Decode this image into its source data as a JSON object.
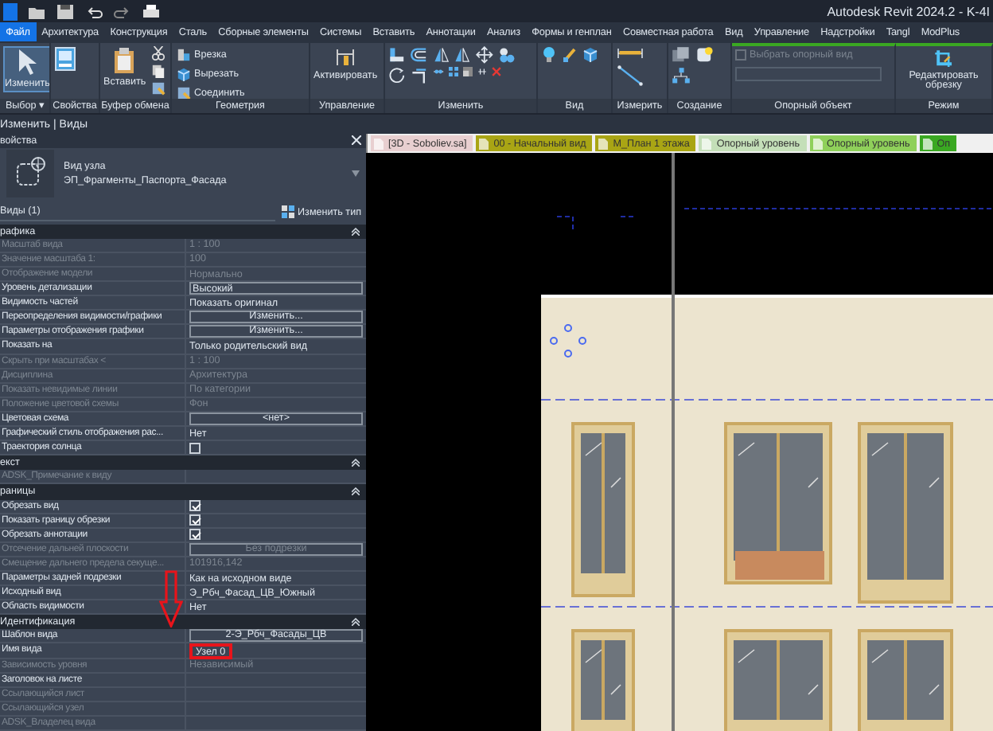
{
  "window": {
    "title": "Autodesk Revit 2024.2 - K-4I"
  },
  "menu": [
    {
      "label": "Файл",
      "selected": true
    },
    {
      "label": "Архитектура",
      "selected": false
    },
    {
      "label": "Конструкция",
      "selected": false
    },
    {
      "label": "Сталь",
      "selected": false
    },
    {
      "label": "Сборные элементы",
      "selected": false
    },
    {
      "label": "Системы",
      "selected": false
    },
    {
      "label": "Вставить",
      "selected": false
    },
    {
      "label": "Аннотации",
      "selected": false
    },
    {
      "label": "Анализ",
      "selected": false
    },
    {
      "label": "Формы и генплан",
      "selected": false
    },
    {
      "label": "Совместная работа",
      "selected": false
    },
    {
      "label": "Вид",
      "selected": false
    },
    {
      "label": "Управление",
      "selected": false
    },
    {
      "label": "Надстройки",
      "selected": false
    },
    {
      "label": "Tangl",
      "selected": false
    },
    {
      "label": "ModPlus",
      "selected": false
    }
  ],
  "ribbon": {
    "panels": [
      {
        "label": "Выбор ▾",
        "buttons": [
          "Изменить"
        ]
      },
      {
        "label": "Свойства"
      },
      {
        "label": "Буфер обмена",
        "buttons": [
          "Вставить"
        ]
      },
      {
        "label": "Геометрия",
        "buttons": [
          "Врезка",
          "Вырезать",
          "Соединить"
        ]
      },
      {
        "label": "Управление",
        "buttons": [
          "Активировать"
        ]
      },
      {
        "label": "Изменить"
      },
      {
        "label": "Вид"
      },
      {
        "label": "Измерить"
      },
      {
        "label": "Создание"
      },
      {
        "label": "Опорный объект",
        "checkbox": {
          "label": "Выбрать опорный вид",
          "checked": false,
          "disabled": true
        }
      },
      {
        "label": "Режим",
        "buttons": [
          "Редактировать обрезку"
        ]
      }
    ]
  },
  "breadcrumb": "Изменить | Виды",
  "properties": {
    "title": "войства",
    "type_name": "Вид узла",
    "type_family": "ЭП_Фрагменты_Паспорта_Фасада",
    "selector": "Виды (1)",
    "edit_type": "Изменить тип",
    "groups": [
      {
        "title": "рафика",
        "rows": [
          {
            "label": "Масштаб вида",
            "value": "1 : 100",
            "kind": "text",
            "disabled": true
          },
          {
            "label": "Значение масштаба    1:",
            "value": "100",
            "kind": "text",
            "disabled": true
          },
          {
            "label": "Отображение модели",
            "value": "Нормально",
            "kind": "text",
            "disabled": true
          },
          {
            "label": "Уровень детализации",
            "value": "Высокий",
            "kind": "field",
            "disabled": false
          },
          {
            "label": "Видимость частей",
            "value": "Показать оригинал",
            "kind": "text",
            "disabled": false
          },
          {
            "label": "Переопределения видимости/графики",
            "value": "Изменить...",
            "kind": "button",
            "disabled": false
          },
          {
            "label": "Параметры отображения графики",
            "value": "Изменить...",
            "kind": "button",
            "disabled": false
          },
          {
            "label": "Показать на",
            "value": "Только родительский вид",
            "kind": "text",
            "disabled": false
          },
          {
            "label": "Скрыть при масштабах <",
            "value": "1 : 100",
            "kind": "text",
            "disabled": true
          },
          {
            "label": "Дисциплина",
            "value": "Архитектура",
            "kind": "text",
            "disabled": true
          },
          {
            "label": "Показать невидимые линии",
            "value": "По категории",
            "kind": "text",
            "disabled": true
          },
          {
            "label": "Положение цветовой схемы",
            "value": "Фон",
            "kind": "text",
            "disabled": true
          },
          {
            "label": "Цветовая схема",
            "value": "<нет>",
            "kind": "button",
            "disabled": false
          },
          {
            "label": "Графический стиль отображения рас...",
            "value": "Нет",
            "kind": "text",
            "disabled": false
          },
          {
            "label": "Траектория солнца",
            "kind": "checkbox",
            "checked": false,
            "disabled": false
          }
        ]
      },
      {
        "title": "екст",
        "rows": [
          {
            "label": "ADSK_Примечание к виду",
            "kind": "text",
            "disabled": true
          }
        ]
      },
      {
        "title": "раницы",
        "rows": [
          {
            "label": "Обрезать вид",
            "kind": "checkbox",
            "checked": true,
            "disabled": false
          },
          {
            "label": "Показать границу обрезки",
            "kind": "checkbox",
            "checked": true,
            "disabled": false
          },
          {
            "label": "Обрезать аннотации",
            "kind": "checkbox",
            "checked": true,
            "disabled": false
          },
          {
            "label": "Отсечение дальней плоскости",
            "value": "Без подрезки",
            "kind": "button",
            "disabled": true
          },
          {
            "label": "Смещение дальнего предела секуще...",
            "value": "101916,142",
            "kind": "text",
            "disabled": true
          },
          {
            "label": "Параметры задней подрезки",
            "value": "Как на исходном виде",
            "kind": "text",
            "disabled": false
          },
          {
            "label": "Исходный вид",
            "value": "Э_Рбч_Фасад_ЦВ_Южный",
            "kind": "text",
            "disabled": false
          },
          {
            "label": "Область видимости",
            "value": "Нет",
            "kind": "text",
            "disabled": false
          }
        ]
      },
      {
        "title": "Идентификация",
        "rows": [
          {
            "label": "Шаблон вида",
            "value": "2-Э_Рбч_Фасады_ЦВ",
            "kind": "button",
            "disabled": false
          },
          {
            "label": "Имя вида",
            "value": "Узел 0",
            "kind": "highlight",
            "disabled": false
          },
          {
            "label": "Зависимость уровня",
            "value": "Независимый",
            "kind": "text",
            "disabled": true
          },
          {
            "label": "Заголовок на листе",
            "kind": "text",
            "disabled": false
          },
          {
            "label": "Ссылающийся лист",
            "kind": "text",
            "disabled": true
          },
          {
            "label": "Ссылающийся узел",
            "kind": "text",
            "disabled": true
          },
          {
            "label": "ADSK_Владелец вида",
            "kind": "text",
            "disabled": true
          }
        ]
      }
    ]
  },
  "view_tabs": [
    {
      "label": "[3D - Soboliev.sa]",
      "color": "#e8cfd0"
    },
    {
      "label": "00 - Начальный вид",
      "color": "#a9a514"
    },
    {
      "label": "М_План 1 этажа",
      "color": "#a9a514"
    },
    {
      "label": "Опорный уровень",
      "color": "#c4dfb8"
    },
    {
      "label": "Опорный уровень",
      "color": "#8fd05a"
    },
    {
      "label": "Оп",
      "color": "#3aa822"
    }
  ]
}
